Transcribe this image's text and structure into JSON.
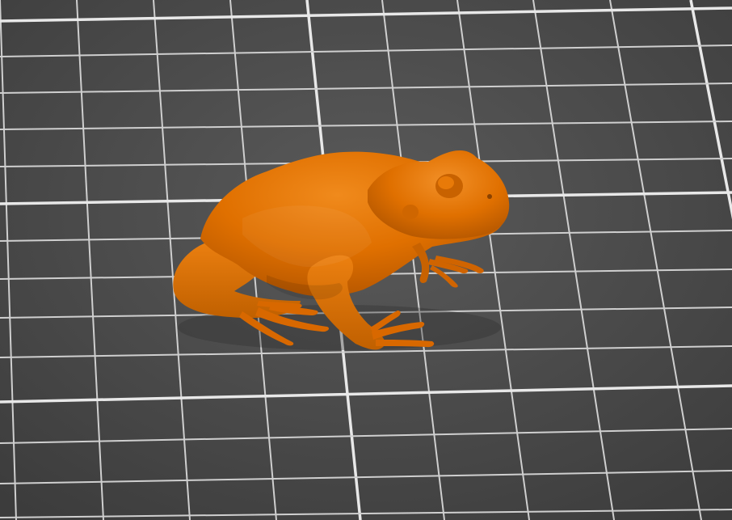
{
  "viewport": {
    "view": "3d-model-viewport",
    "background_color": "#4a4a4a",
    "grid_color": "#e8e8e8",
    "minor_grid_color": "#cfcfcf"
  },
  "model": {
    "name_icon": "frog-model",
    "color": "#e07000",
    "shade_color": "#b85800",
    "highlight_color": "#f08a1c"
  }
}
